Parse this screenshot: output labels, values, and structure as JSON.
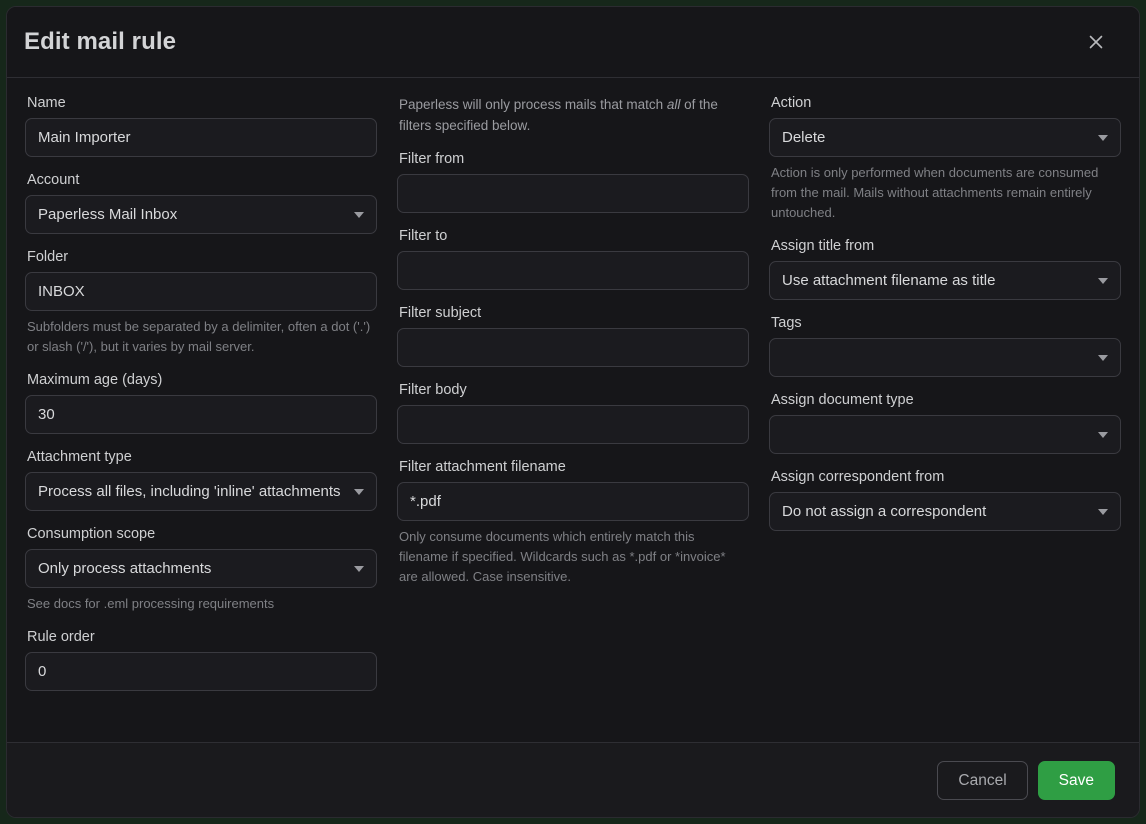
{
  "modal": {
    "title": "Edit mail rule",
    "close_icon": "close-icon"
  },
  "colors": {
    "accent_save": "#2f9e44",
    "panel_bg": "#161619",
    "input_bg": "#1b1b1f",
    "border": "#3a3a40",
    "text": "#d8d9db",
    "muted_text": "#7f8085"
  },
  "left_column": {
    "name": {
      "label": "Name",
      "value": "Main Importer"
    },
    "account": {
      "label": "Account",
      "value": "Paperless Mail Inbox"
    },
    "folder": {
      "label": "Folder",
      "value": "INBOX",
      "hint": "Subfolders must be separated by a delimiter, often a dot ('.') or slash ('/'), but it varies by mail server."
    },
    "maximum_age": {
      "label": "Maximum age (days)",
      "value": "30"
    },
    "attachment_type": {
      "label": "Attachment type",
      "value": "Process all files, including 'inline' attachments"
    },
    "consumption_scope": {
      "label": "Consumption scope",
      "value": "Only process attachments",
      "hint": "See docs for .eml processing requirements"
    },
    "rule_order": {
      "label": "Rule order",
      "value": "0"
    }
  },
  "middle_column": {
    "intro_before": "Paperless will only process mails that match ",
    "intro_emphasis": "all",
    "intro_after": " of the filters specified below.",
    "filter_from": {
      "label": "Filter from",
      "value": ""
    },
    "filter_to": {
      "label": "Filter to",
      "value": ""
    },
    "filter_subject": {
      "label": "Filter subject",
      "value": ""
    },
    "filter_body": {
      "label": "Filter body",
      "value": ""
    },
    "filter_attachment_filename": {
      "label": "Filter attachment filename",
      "value": "*.pdf",
      "hint": "Only consume documents which entirely match this filename if specified. Wildcards such as *.pdf or *invoice* are allowed. Case insensitive."
    }
  },
  "right_column": {
    "action": {
      "label": "Action",
      "value": "Delete",
      "hint": "Action is only performed when documents are consumed from the mail. Mails without attachments remain entirely untouched."
    },
    "assign_title_from": {
      "label": "Assign title from",
      "value": "Use attachment filename as title"
    },
    "tags": {
      "label": "Tags",
      "value": ""
    },
    "assign_document_type": {
      "label": "Assign document type",
      "value": ""
    },
    "assign_correspondent_from": {
      "label": "Assign correspondent from",
      "value": "Do not assign a correspondent"
    }
  },
  "footer": {
    "cancel_label": "Cancel",
    "save_label": "Save"
  }
}
